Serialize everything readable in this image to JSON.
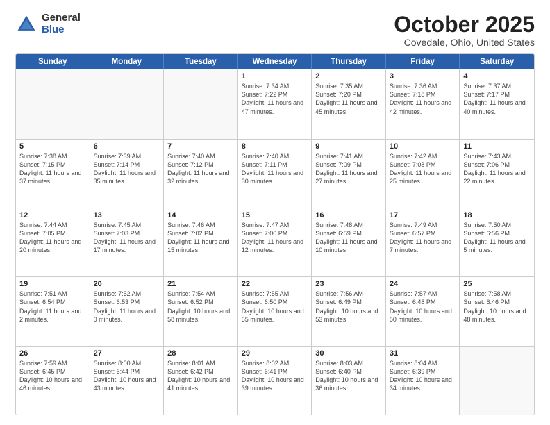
{
  "logo": {
    "general": "General",
    "blue": "Blue"
  },
  "title": "October 2025",
  "location": "Covedale, Ohio, United States",
  "header_days": [
    "Sunday",
    "Monday",
    "Tuesday",
    "Wednesday",
    "Thursday",
    "Friday",
    "Saturday"
  ],
  "weeks": [
    [
      {
        "day": "",
        "info": ""
      },
      {
        "day": "",
        "info": ""
      },
      {
        "day": "",
        "info": ""
      },
      {
        "day": "1",
        "info": "Sunrise: 7:34 AM\nSunset: 7:22 PM\nDaylight: 11 hours and 47 minutes."
      },
      {
        "day": "2",
        "info": "Sunrise: 7:35 AM\nSunset: 7:20 PM\nDaylight: 11 hours and 45 minutes."
      },
      {
        "day": "3",
        "info": "Sunrise: 7:36 AM\nSunset: 7:18 PM\nDaylight: 11 hours and 42 minutes."
      },
      {
        "day": "4",
        "info": "Sunrise: 7:37 AM\nSunset: 7:17 PM\nDaylight: 11 hours and 40 minutes."
      }
    ],
    [
      {
        "day": "5",
        "info": "Sunrise: 7:38 AM\nSunset: 7:15 PM\nDaylight: 11 hours and 37 minutes."
      },
      {
        "day": "6",
        "info": "Sunrise: 7:39 AM\nSunset: 7:14 PM\nDaylight: 11 hours and 35 minutes."
      },
      {
        "day": "7",
        "info": "Sunrise: 7:40 AM\nSunset: 7:12 PM\nDaylight: 11 hours and 32 minutes."
      },
      {
        "day": "8",
        "info": "Sunrise: 7:40 AM\nSunset: 7:11 PM\nDaylight: 11 hours and 30 minutes."
      },
      {
        "day": "9",
        "info": "Sunrise: 7:41 AM\nSunset: 7:09 PM\nDaylight: 11 hours and 27 minutes."
      },
      {
        "day": "10",
        "info": "Sunrise: 7:42 AM\nSunset: 7:08 PM\nDaylight: 11 hours and 25 minutes."
      },
      {
        "day": "11",
        "info": "Sunrise: 7:43 AM\nSunset: 7:06 PM\nDaylight: 11 hours and 22 minutes."
      }
    ],
    [
      {
        "day": "12",
        "info": "Sunrise: 7:44 AM\nSunset: 7:05 PM\nDaylight: 11 hours and 20 minutes."
      },
      {
        "day": "13",
        "info": "Sunrise: 7:45 AM\nSunset: 7:03 PM\nDaylight: 11 hours and 17 minutes."
      },
      {
        "day": "14",
        "info": "Sunrise: 7:46 AM\nSunset: 7:02 PM\nDaylight: 11 hours and 15 minutes."
      },
      {
        "day": "15",
        "info": "Sunrise: 7:47 AM\nSunset: 7:00 PM\nDaylight: 11 hours and 12 minutes."
      },
      {
        "day": "16",
        "info": "Sunrise: 7:48 AM\nSunset: 6:59 PM\nDaylight: 11 hours and 10 minutes."
      },
      {
        "day": "17",
        "info": "Sunrise: 7:49 AM\nSunset: 6:57 PM\nDaylight: 11 hours and 7 minutes."
      },
      {
        "day": "18",
        "info": "Sunrise: 7:50 AM\nSunset: 6:56 PM\nDaylight: 11 hours and 5 minutes."
      }
    ],
    [
      {
        "day": "19",
        "info": "Sunrise: 7:51 AM\nSunset: 6:54 PM\nDaylight: 11 hours and 2 minutes."
      },
      {
        "day": "20",
        "info": "Sunrise: 7:52 AM\nSunset: 6:53 PM\nDaylight: 11 hours and 0 minutes."
      },
      {
        "day": "21",
        "info": "Sunrise: 7:54 AM\nSunset: 6:52 PM\nDaylight: 10 hours and 58 minutes."
      },
      {
        "day": "22",
        "info": "Sunrise: 7:55 AM\nSunset: 6:50 PM\nDaylight: 10 hours and 55 minutes."
      },
      {
        "day": "23",
        "info": "Sunrise: 7:56 AM\nSunset: 6:49 PM\nDaylight: 10 hours and 53 minutes."
      },
      {
        "day": "24",
        "info": "Sunrise: 7:57 AM\nSunset: 6:48 PM\nDaylight: 10 hours and 50 minutes."
      },
      {
        "day": "25",
        "info": "Sunrise: 7:58 AM\nSunset: 6:46 PM\nDaylight: 10 hours and 48 minutes."
      }
    ],
    [
      {
        "day": "26",
        "info": "Sunrise: 7:59 AM\nSunset: 6:45 PM\nDaylight: 10 hours and 46 minutes."
      },
      {
        "day": "27",
        "info": "Sunrise: 8:00 AM\nSunset: 6:44 PM\nDaylight: 10 hours and 43 minutes."
      },
      {
        "day": "28",
        "info": "Sunrise: 8:01 AM\nSunset: 6:42 PM\nDaylight: 10 hours and 41 minutes."
      },
      {
        "day": "29",
        "info": "Sunrise: 8:02 AM\nSunset: 6:41 PM\nDaylight: 10 hours and 39 minutes."
      },
      {
        "day": "30",
        "info": "Sunrise: 8:03 AM\nSunset: 6:40 PM\nDaylight: 10 hours and 36 minutes."
      },
      {
        "day": "31",
        "info": "Sunrise: 8:04 AM\nSunset: 6:39 PM\nDaylight: 10 hours and 34 minutes."
      },
      {
        "day": "",
        "info": ""
      }
    ]
  ]
}
